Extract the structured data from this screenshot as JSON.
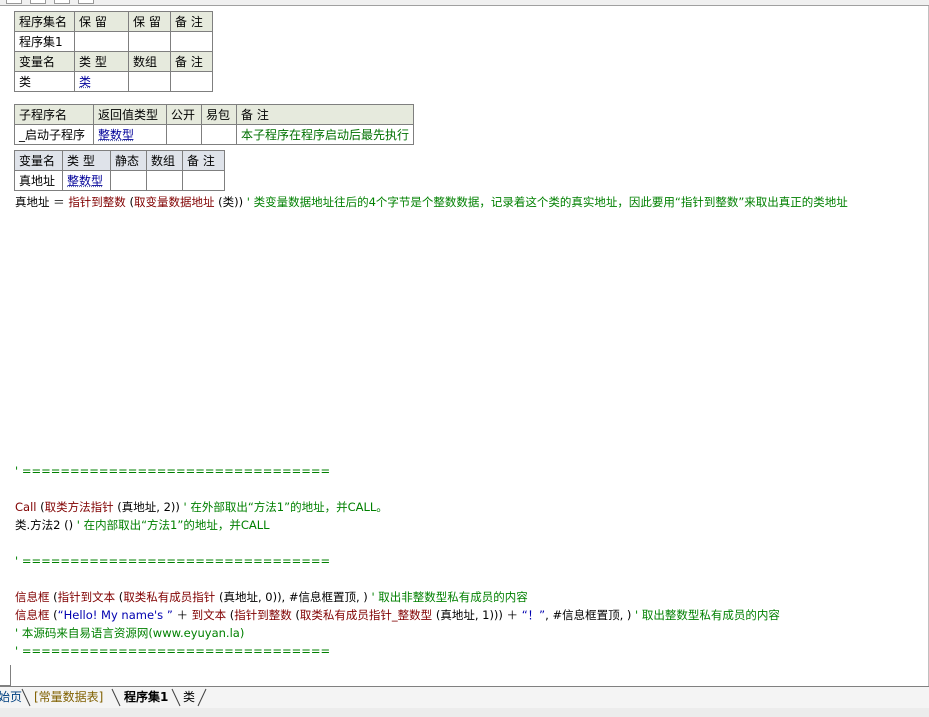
{
  "assembly_table": {
    "headers": [
      "程序集名",
      "保 留",
      "保 留",
      "备 注"
    ],
    "name": "程序集1",
    "var_headers": [
      "变量名",
      "类 型",
      "数组",
      "备 注"
    ],
    "var_row": {
      "name": "类",
      "type": "类"
    }
  },
  "sub_table": {
    "headers": [
      "子程序名",
      "返回值类型",
      "公开",
      "易包",
      "备 注"
    ],
    "name": "_启动子程序",
    "return_type": "整数型",
    "note": "本子程序在程序启动后最先执行"
  },
  "local_table": {
    "headers": [
      "变量名",
      "类 型",
      "静态",
      "数组",
      "备 注"
    ],
    "var_row": {
      "name": "真地址",
      "type": "整数型"
    }
  },
  "code": {
    "line1": {
      "lhs": "真地址",
      "eq": " ＝ ",
      "fn1": "指针到整数",
      "p1": " (",
      "fn2": "取变量数据地址",
      "p2": " (类)) ",
      "comment": "' 类变量数据地址往后的4个字节是个整数数据，记录着这个类的真实地址，因此要用“指针到整数”来取出真正的类地址"
    },
    "sep1": "' ================================",
    "call_line": {
      "kw": "Call",
      "p1": " (",
      "fn": "取类方法指针",
      "args": " (真地址, 2)) ",
      "comment": "' 在外部取出“方法1”的地址，并CALL。"
    },
    "method_line": {
      "expr": "类.方法2 () ",
      "comment": "' 在内部取出“方法1”的地址，并CALL"
    },
    "sep2": "' ================================",
    "msg1": {
      "fn": "信息框",
      "p1": " (",
      "fn2": "指针到文本",
      "p2": " (",
      "fn3": "取类私有成员指针",
      "args": " (真地址, 0)), #信息框置顶, ) ",
      "comment": "' 取出非整数型私有成员的内容"
    },
    "msg2": {
      "fn": "信息框",
      "p1": " (",
      "str1": "“Hello! My name's ”",
      "plus1": " ＋ ",
      "fn2": "到文本",
      "p2": " (",
      "fn3": "指针到整数",
      "p3": " (",
      "fn4": "取类私有成员指针_整数型",
      "args": " (真地址, 1))) ＋ ",
      "str2": "“！”",
      "rest": ", #信息框置顶, ) ",
      "comment": "' 取出整数型私有成员的内容"
    },
    "source_comment": "' 本源码来自易语言资源网(www.eyuyan.la)",
    "sep3": "' ================================"
  },
  "tabs": [
    {
      "label": "始页"
    },
    {
      "label": "[常量数据表]"
    },
    {
      "label": "程序集1"
    },
    {
      "label": "类"
    }
  ]
}
